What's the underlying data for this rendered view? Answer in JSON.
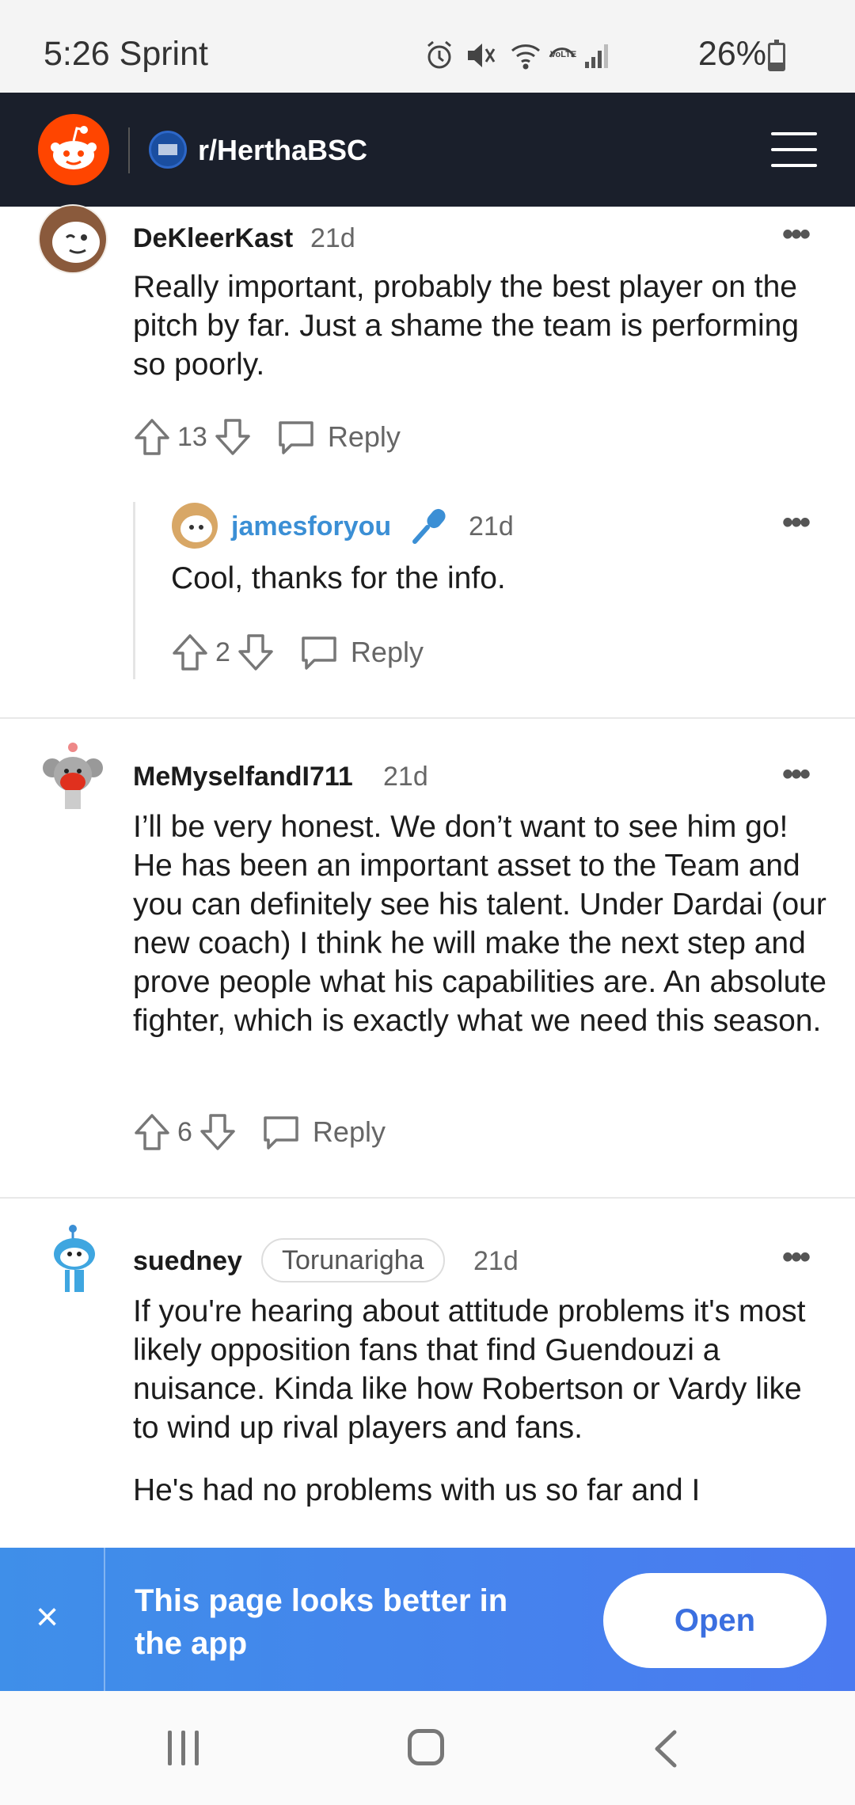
{
  "status_bar": {
    "time": "5:26 Sprint",
    "battery": "26%",
    "icons": [
      "alarm-icon",
      "mute-icon",
      "wifi-icon",
      "volte-icon",
      "signal-icon"
    ]
  },
  "header": {
    "subreddit": "r/HerthaBSC"
  },
  "comments": [
    {
      "username": "DeKleerKast",
      "time": "21d",
      "body": "Really important, probably the best player on the pitch by far. Just a shame the team is performing so poorly.",
      "votes": "13",
      "reply_label": "Reply"
    },
    {
      "username": "jamesforyou",
      "time": "21d",
      "body": "Cool, thanks for the info.",
      "votes": "2",
      "reply_label": "Reply"
    },
    {
      "username": "MeMyselfandI711",
      "time": "21d",
      "body": "I’ll be very honest. We don’t want to see him go! He has been an important asset to the Team and you can definitely see his talent. Under Dardai (our new coach) I think he will make the next step and prove people what his capabilities are. An absolute fighter, which is exactly what we need this season.",
      "votes": "6",
      "reply_label": "Reply"
    },
    {
      "username": "suedney",
      "flair": "Torunarigha",
      "time": "21d",
      "body": "If you're hearing about attitude problems it's most likely opposition fans that find Guendouzi a nuisance. Kinda like how Robertson or Vardy like to wind up rival players and fans.",
      "body2": "He's had no problems with us so far and I"
    }
  ],
  "banner": {
    "close": "×",
    "text": "This page looks better in the app",
    "open_label": "Open"
  },
  "colors": {
    "header_bg": "#1a1f2b",
    "reddit_orange": "#ff4500",
    "op_blue": "#3b8fd5",
    "banner_blue": "#4a7af0"
  }
}
